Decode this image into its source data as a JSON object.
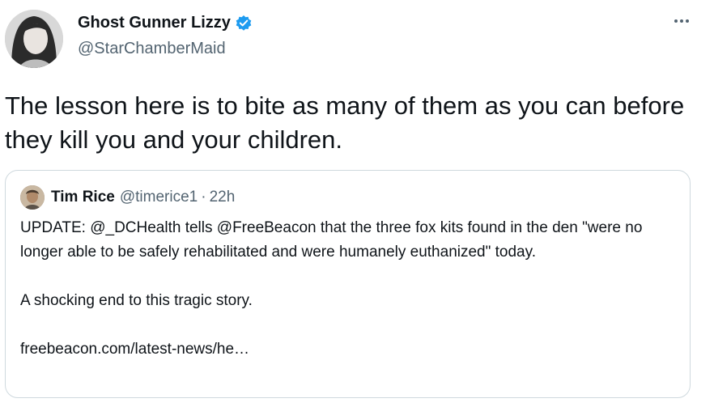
{
  "author": {
    "name": "Ghost Gunner Lizzy",
    "handle": "@StarChamberMaid",
    "verified_color": "#1d9bf0"
  },
  "more_icon": "more-horizontal-icon",
  "tweet_text": "The lesson here is to bite as many of them as you can before they kill you and your children.",
  "quote": {
    "name": "Tim Rice",
    "handle": "@timerice1",
    "separator": "·",
    "time": "22h",
    "para1": "UPDATE: @_DCHealth tells @FreeBeacon that the three fox kits found in the den \"were no longer able to be safely rehabilitated and were humanely euthanized\" today.",
    "para2": "A shocking end to this tragic story.",
    "link": "freebeacon.com/latest-news/he…"
  }
}
